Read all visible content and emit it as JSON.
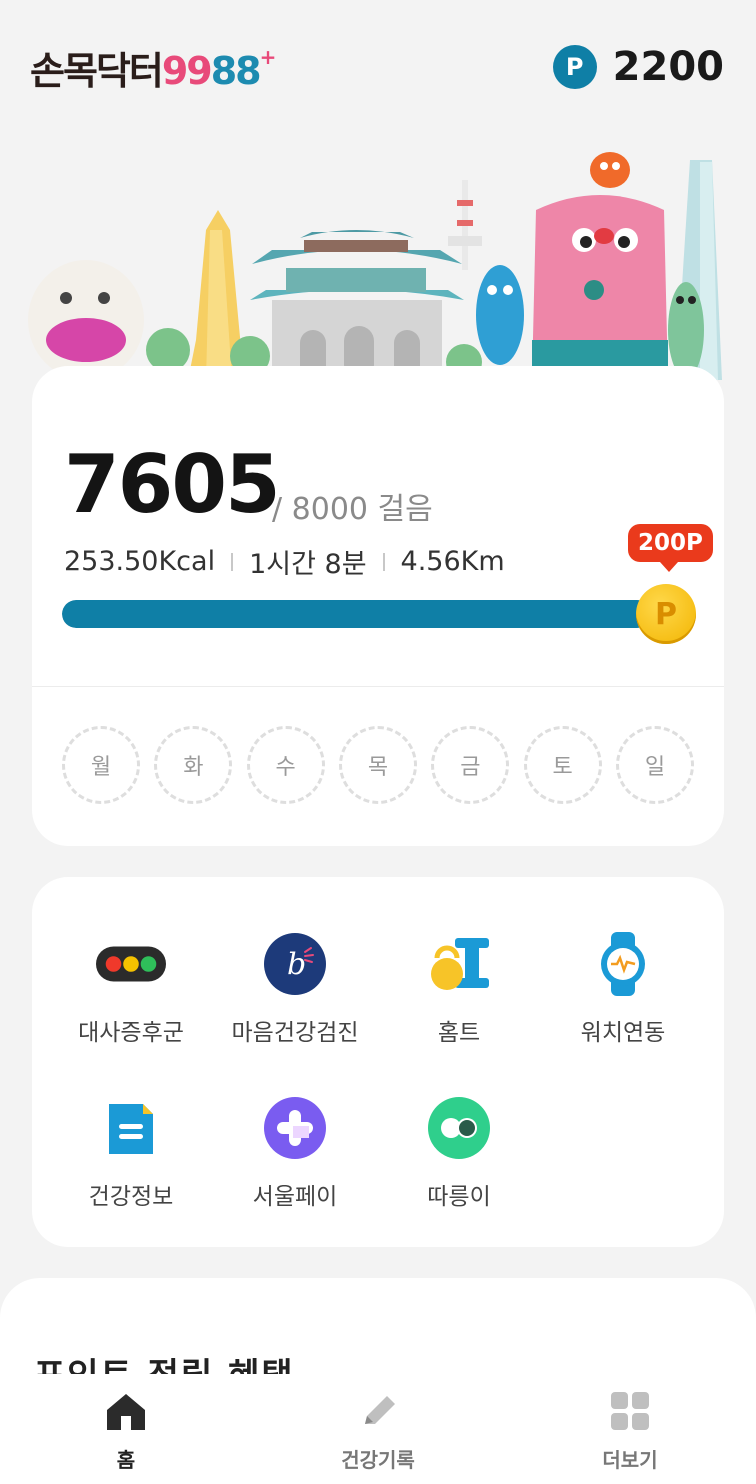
{
  "header": {
    "logo_text": "손목닥터",
    "logo_num_a": "99",
    "logo_num_b": "88",
    "logo_plus": "+",
    "point_badge": "P",
    "point_value": "2200"
  },
  "steps": {
    "count": "7605",
    "goal_text": "/ 8000 걸음",
    "kcal": "253.50Kcal",
    "duration": "1시간 8분",
    "distance": "4.56Km",
    "reward_badge": "200P",
    "coin_letter": "P",
    "progress_fraction": 0.95,
    "days": [
      "월",
      "화",
      "수",
      "목",
      "금",
      "토",
      "일"
    ]
  },
  "menu": {
    "items": [
      {
        "label": "대사증후군",
        "icon": "traffic-light-icon"
      },
      {
        "label": "마음건강검진",
        "icon": "mind-health-icon"
      },
      {
        "label": "홈트",
        "icon": "dumbbell-kettlebell-icon"
      },
      {
        "label": "워치연동",
        "icon": "smartwatch-icon"
      },
      {
        "label": "건강정보",
        "icon": "document-icon"
      },
      {
        "label": "서울페이",
        "icon": "seoul-pay-icon"
      },
      {
        "label": "따릉이",
        "icon": "bike-share-icon"
      }
    ]
  },
  "section": {
    "title": "포인트 적립 혜택"
  },
  "tabbar": {
    "items": [
      {
        "label": "홈",
        "icon": "home-icon",
        "active": true
      },
      {
        "label": "건강기록",
        "icon": "pencil-icon",
        "active": false
      },
      {
        "label": "더보기",
        "icon": "grid-icon",
        "active": false
      }
    ]
  },
  "colors": {
    "accent": "#0f7fa6",
    "reward": "#ea3a1c",
    "coin": "#f2b400"
  }
}
